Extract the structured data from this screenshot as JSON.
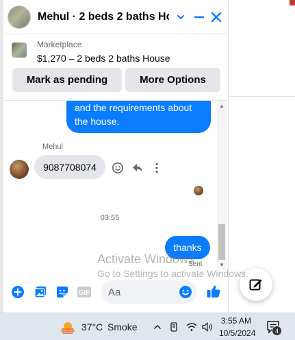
{
  "header": {
    "title": "Mehul · 2 beds 2 baths Ho…"
  },
  "marketplace": {
    "label": "Marketplace",
    "listing": "$1,270 – 2 beds 2 baths House",
    "mark_pending_label": "Mark as pending",
    "more_options_label": "More Options"
  },
  "messages": {
    "outgoing_1": "and the requirements about the house.",
    "sender_name": "Mehul",
    "incoming_1": "9087708074",
    "timestamp": "03:55",
    "outgoing_2": "thanks",
    "status": "Sent"
  },
  "composer": {
    "placeholder": "Aa",
    "gif_label": "GIF"
  },
  "watermark": {
    "line1": "Activate Windows",
    "line2": "Go to Settings to activate Windows."
  },
  "taskbar": {
    "temperature": "37°C",
    "condition": "Smoke",
    "time": "3:55 AM",
    "date": "10/5/2024",
    "notification_count": "4"
  },
  "colors": {
    "messenger_blue": "#0a7cff",
    "button_gray": "#e4e6eb"
  }
}
